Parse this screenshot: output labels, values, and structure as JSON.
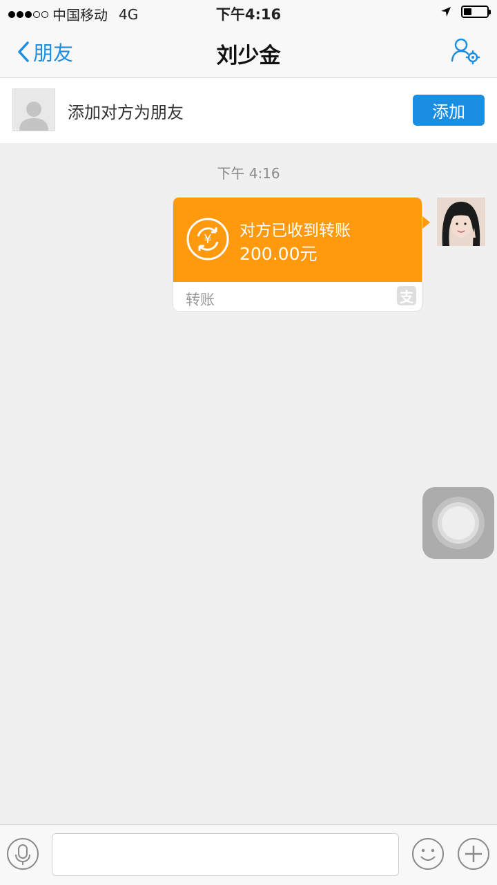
{
  "status_bar": {
    "carrier": "中国移动",
    "network": "4G",
    "time": "下午4:16",
    "signal_strength_filled": 3,
    "signal_strength_total": 5,
    "battery_level": 0.3
  },
  "nav": {
    "back_label": "朋友",
    "title": "刘少金",
    "settings_icon": "user-settings-icon"
  },
  "add_friend": {
    "prompt": "添加对方为朋友",
    "button_label": "添加"
  },
  "chat": {
    "timestamp": "下午 4:16",
    "messages": [
      {
        "type": "transfer",
        "status": "对方已收到转账",
        "amount": "200.00元",
        "footer_label": "转账",
        "accent_color": "#ff9a0e"
      }
    ]
  },
  "input_bar": {
    "placeholder": "",
    "voice_icon": "microphone-icon",
    "emoji_icon": "smiley-icon",
    "plus_icon": "plus-icon"
  },
  "colors": {
    "accent": "#1a8ee1",
    "transfer": "#ff9a0e",
    "background": "#f0f0f0"
  }
}
